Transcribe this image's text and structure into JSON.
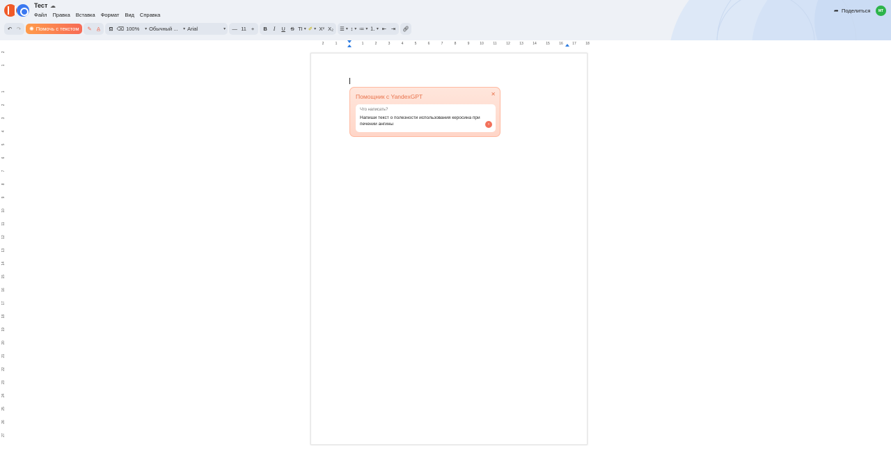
{
  "header": {
    "title": "Тест",
    "menu": [
      "Файл",
      "Правка",
      "Вставка",
      "Формат",
      "Вид",
      "Справка"
    ],
    "share_label": "Поделиться",
    "avatar_initials": "МТ"
  },
  "toolbar": {
    "ai_button": "Помочь с текстом",
    "zoom": "100%",
    "style": "Обычный ...",
    "font": "Arial",
    "font_size": "11"
  },
  "ruler": {
    "h_labels": [
      "2",
      "1",
      "1",
      "2",
      "3",
      "4",
      "5",
      "6",
      "7",
      "8",
      "9",
      "10",
      "11",
      "12",
      "13",
      "14",
      "15",
      "16",
      "17",
      "18"
    ],
    "v_labels": [
      "2",
      "1",
      "1",
      "2",
      "3",
      "4",
      "5",
      "6",
      "7",
      "8",
      "9",
      "10",
      "11",
      "12",
      "13",
      "14",
      "15",
      "16",
      "17",
      "18",
      "19",
      "20",
      "21",
      "22",
      "23",
      "24",
      "25",
      "26",
      "27"
    ]
  },
  "assistant": {
    "title": "Помощник с YandexGPT",
    "prompt_label": "Что написать?",
    "prompt_text": "Напиши текст о полезности использования керосина при печении ангины"
  },
  "colors": {
    "accent": "#f2705a",
    "brand_orange": "#f05a28",
    "brand_blue": "#3a78f0",
    "avatar": "#2db44b"
  },
  "icons": [
    "undo-icon",
    "redo-icon",
    "sparkle-icon",
    "magic-wand-icon",
    "text-color-icon",
    "paint-format-icon",
    "clear-format-icon",
    "bold-icon",
    "italic-icon",
    "underline-icon",
    "strikethrough-icon",
    "text-size-icon",
    "highlight-icon",
    "superscript-icon",
    "subscript-icon",
    "align-icon",
    "line-spacing-icon",
    "bullet-list-icon",
    "numbered-list-icon",
    "indent-decrease-icon",
    "indent-increase-icon",
    "link-icon",
    "share-icon",
    "cloud-icon",
    "close-icon",
    "send-icon"
  ]
}
